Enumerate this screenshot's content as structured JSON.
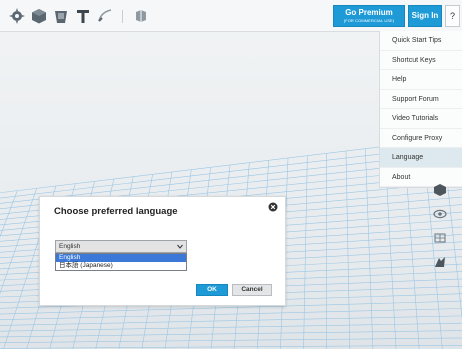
{
  "toolbar": {
    "tools": [
      {
        "icon": "gear-shape-icon"
      },
      {
        "icon": "solid-box-icon"
      },
      {
        "icon": "cup-shape-icon"
      },
      {
        "icon": "text-tool-icon"
      },
      {
        "icon": "sketch-tool-icon"
      },
      {
        "icon": "group-shape-icon"
      }
    ],
    "premium_label": "Go Premium",
    "premium_sub": "(FOR COMMERCIAL USE)",
    "signin_label": "Sign In",
    "help_label": "?"
  },
  "help_menu": {
    "items": [
      "Quick Start Tips",
      "Shortcut Keys",
      "Help",
      "Support Forum",
      "Video Tutorials",
      "Configure Proxy",
      "Language",
      "About"
    ],
    "active_item": "Language"
  },
  "side_tools": [
    "cube-view-icon",
    "eye-icon",
    "scale-icon",
    "magnet-icon"
  ],
  "dialog": {
    "title": "Choose preferred language",
    "selected_value": "English",
    "options": [
      "English",
      "日本語 (Japanese)"
    ],
    "ok_label": "OK",
    "cancel_label": "Cancel"
  },
  "colors": {
    "accent": "#1e9ad7",
    "selection": "#3b78d8",
    "menu_active": "#dde8ef",
    "grid_line": "#9cc6e4"
  }
}
